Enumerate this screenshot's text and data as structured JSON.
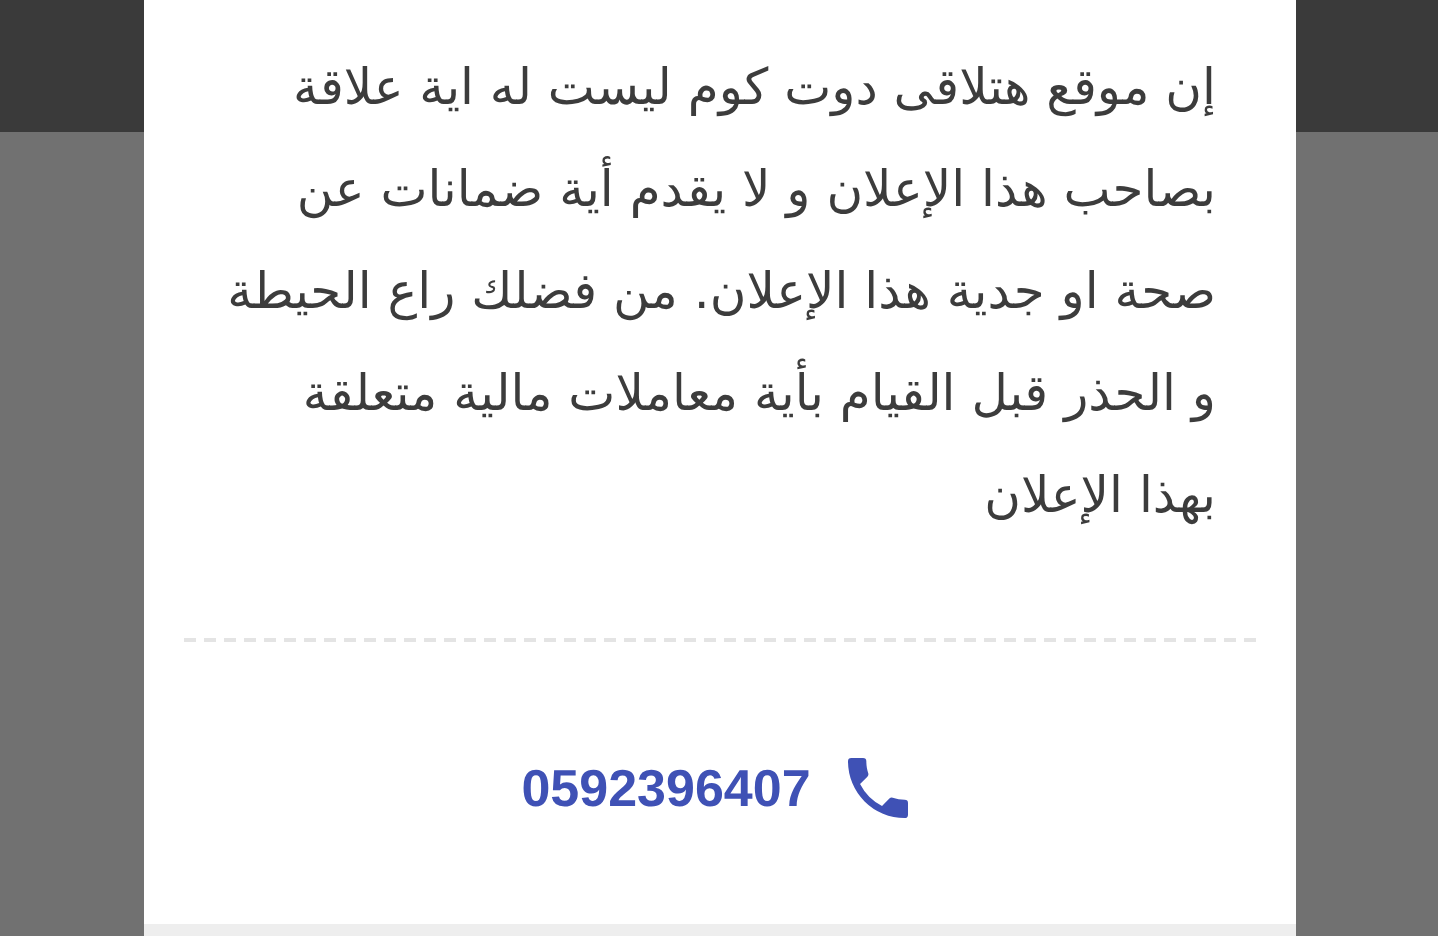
{
  "dialog": {
    "message": "إن موقع هتلاقى دوت كوم ليست له اية علاقة بصاحب هذا الإعلان و لا يقدم أية ضمانات عن صحة او جدية هذا الإعلان. من فضلك راع الحيطة و الحذر قبل القيام بأية معاملات مالية متعلقة بهذا الإعلان",
    "phone": "0592396407"
  }
}
